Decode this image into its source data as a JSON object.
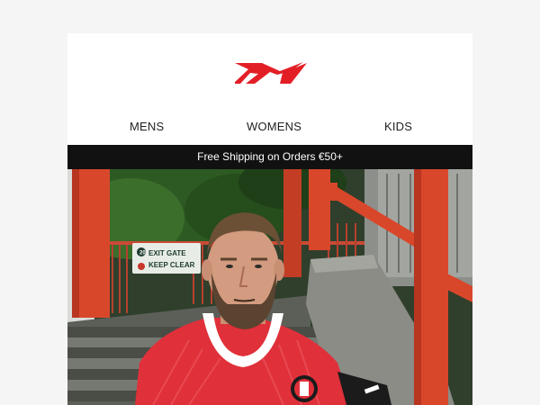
{
  "brand": {
    "logo_icon": "reebok-vector-logo",
    "color": "#e31f26"
  },
  "nav": {
    "items": [
      {
        "label": "MENS"
      },
      {
        "label": "WOMENS"
      },
      {
        "label": "KIDS"
      }
    ]
  },
  "promo": {
    "text": "Free Shipping on Orders €50+"
  },
  "hero": {
    "sign": {
      "number": "20",
      "line1": "EXIT GATE",
      "line2": "KEEP CLEAR"
    }
  },
  "colors": {
    "background": "#f5f5f5",
    "promo_bg": "#111111",
    "rail": "#d9472b",
    "jersey": "#e0303a"
  }
}
